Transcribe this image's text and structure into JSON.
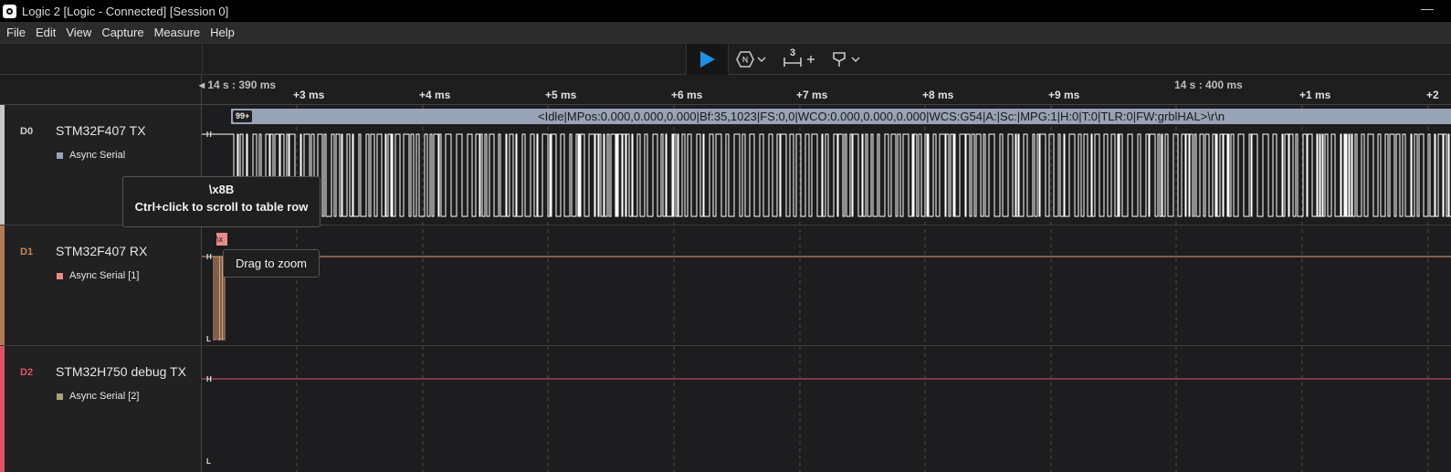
{
  "window": {
    "title": "Logic 2 [Logic - Connected] [Session 0]"
  },
  "menu": [
    "File",
    "Edit",
    "View",
    "Capture",
    "Measure",
    "Help"
  ],
  "toolbar": {
    "trigger_count": "3"
  },
  "timeline": {
    "major": [
      {
        "label": "◂ 14 s : 390 ms"
      },
      {
        "label": "14 s : 400 ms"
      }
    ],
    "minor": [
      "+3 ms",
      "+4 ms",
      "+5 ms",
      "+6 ms",
      "+7 ms",
      "+8 ms",
      "+9 ms",
      "+1 ms",
      "+2"
    ]
  },
  "channels": [
    {
      "id": "D0",
      "name": "STM32F407 TX",
      "analyzer": "Async Serial",
      "stripe": "#c8c8c8",
      "id_color": "#d0d0d0",
      "swatch": "#99a3b6"
    },
    {
      "id": "D1",
      "name": "STM32F407 RX",
      "analyzer": "Async Serial [1]",
      "stripe": "#b47a52",
      "id_color": "#c98757",
      "swatch": "#e98b86"
    },
    {
      "id": "D2",
      "name": "STM32H750 debug TX",
      "analyzer": "Async Serial [2]",
      "stripe": "#e0506a",
      "id_color": "#e0506a",
      "swatch": "#a7a17d"
    }
  ],
  "levels": {
    "high": "H",
    "low": "L"
  },
  "decode": {
    "badge": "99+",
    "text": "<Idle|MPos:0.000,0.000,0.000|Bf:35,1023|FS:0,0|WCO:0.000,0.000,0.000|WCS:G54|A:|Sc:|MPG:1|H:0|T:0|TLR:0|FW:grblHAL>\\r\\n"
  },
  "rx_chip": "\\x",
  "tooltip_byte": {
    "value": "\\x8B",
    "hint": "Ctrl+click to scroll to table row"
  },
  "tooltip_zoom": "Drag to zoom",
  "colors": {
    "tx_wave": "#ffffff",
    "rx_wave": "#e0a27a",
    "dbg_wave": "#e0506a",
    "accent": "#1e90e8"
  }
}
